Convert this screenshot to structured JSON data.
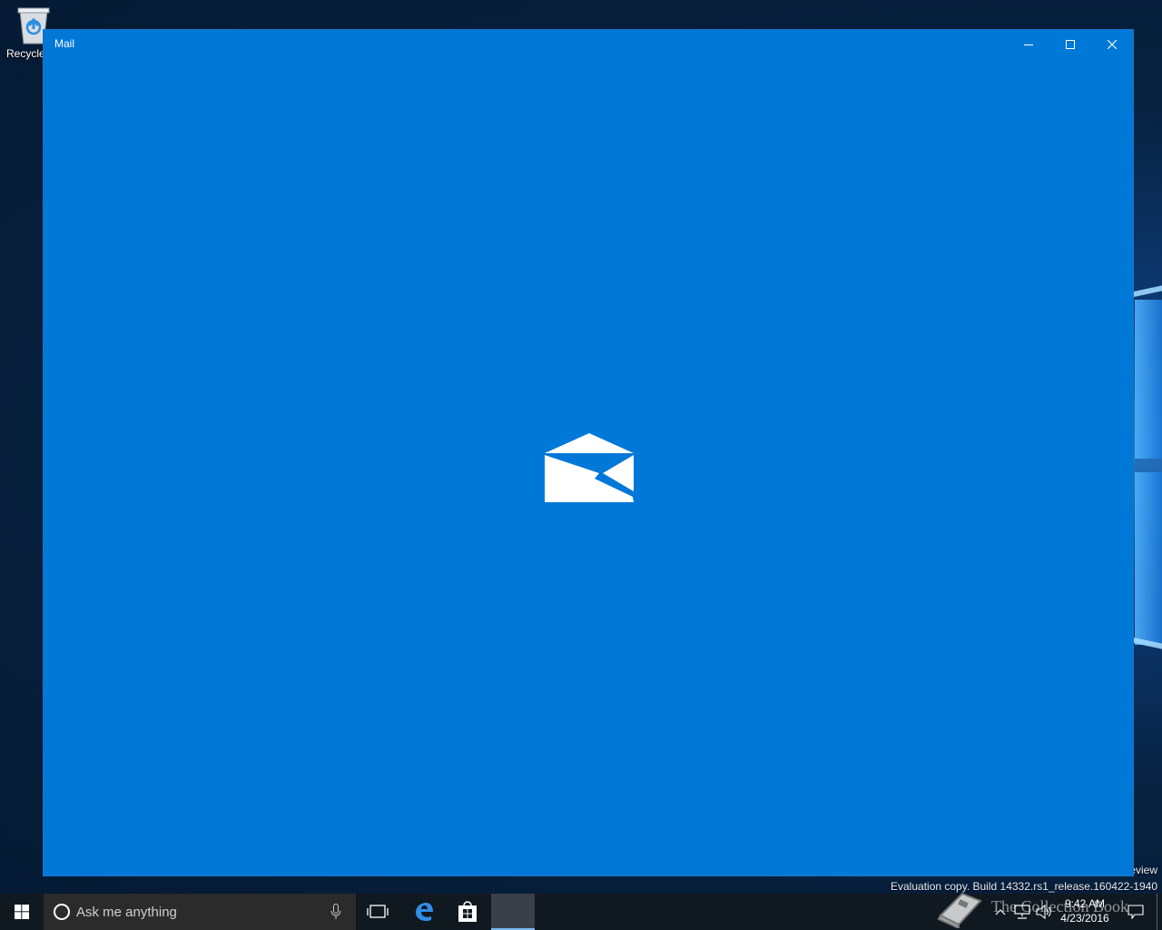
{
  "desktop": {
    "recycle_bin_label": "Recycle",
    "watermark_line1": "eview",
    "watermark_line2": "Evaluation copy. Build 14332.rs1_release.160422-1940",
    "overlay_text": "The Collection Book"
  },
  "window": {
    "title": "Mail",
    "minimize_icon": "minimize-icon",
    "maximize_icon": "maximize-icon",
    "close_icon": "close-icon",
    "splash_icon": "mail-envelope-icon",
    "background_color": "#0078d7"
  },
  "taskbar": {
    "search_placeholder": "Ask me anything",
    "apps": [
      "task-view",
      "edge",
      "store",
      "mail"
    ],
    "clock_time": "9:42 AM",
    "clock_date": "4/23/2016"
  }
}
